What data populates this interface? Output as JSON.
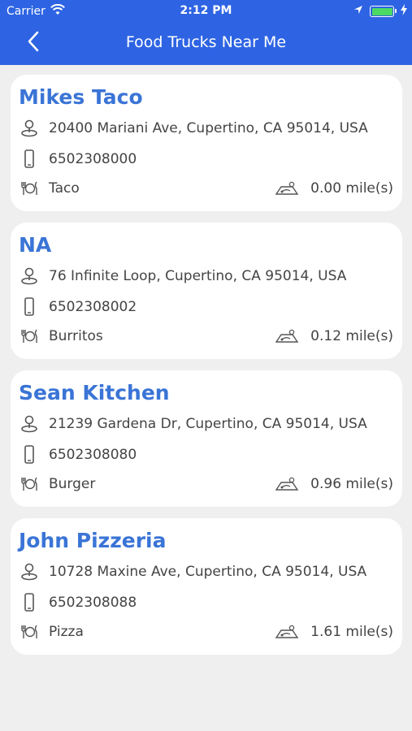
{
  "status_bar": {
    "carrier": "Carrier",
    "time": "2:12 PM"
  },
  "nav": {
    "title": "Food Trucks Near Me",
    "back_icon": "chevron-left-icon"
  },
  "colors": {
    "nav_bg": "#2e64e3",
    "name_text": "#3a74d6",
    "background": "#efefef"
  },
  "trucks": [
    {
      "name": "Mikes Taco",
      "address": "20400 Mariani Ave, Cupertino, CA 95014, USA",
      "phone": "6502308000",
      "food": "Taco",
      "distance": "0.00 mile(s)"
    },
    {
      "name": "NA",
      "address": "76 Infinite Loop, Cupertino, CA 95014, USA",
      "phone": "6502308002",
      "food": "Burritos",
      "distance": "0.12 mile(s)"
    },
    {
      "name": "Sean Kitchen",
      "address": "21239 Gardena Dr, Cupertino, CA 95014, USA",
      "phone": "6502308080",
      "food": "Burger",
      "distance": "0.96 mile(s)"
    },
    {
      "name": "John Pizzeria",
      "address": "10728 Maxine Ave, Cupertino, CA 95014, USA",
      "phone": "6502308088",
      "food": "Pizza",
      "distance": "1.61 mile(s)"
    }
  ]
}
